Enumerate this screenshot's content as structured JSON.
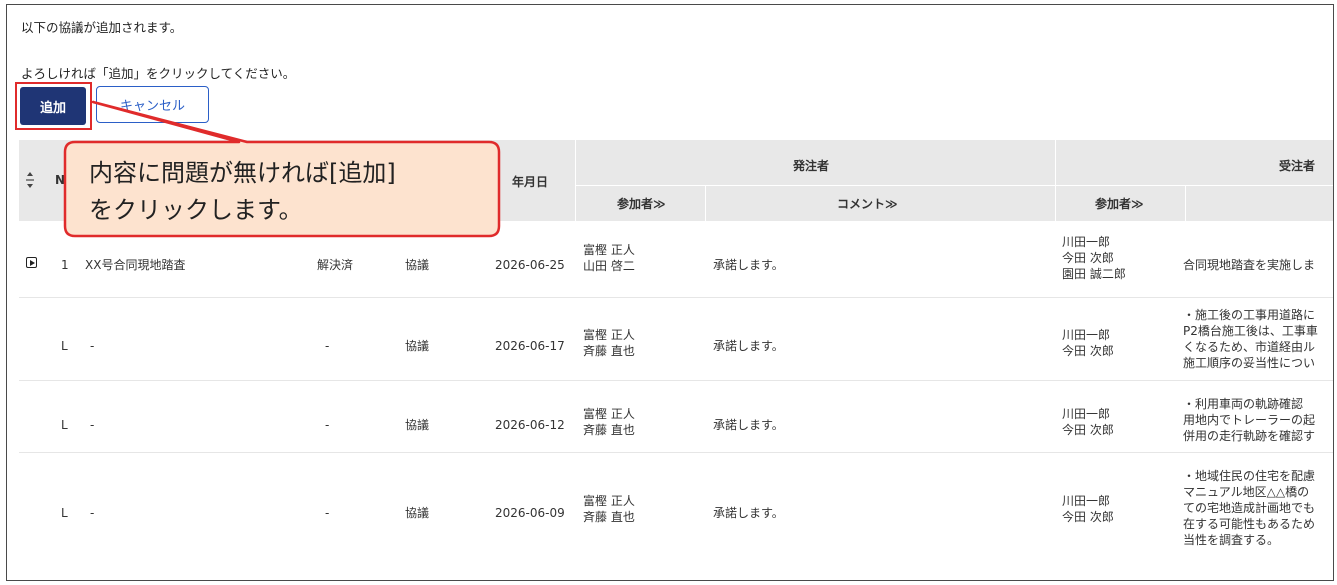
{
  "messages": {
    "line1": "以下の協議が追加されます。",
    "line2": "よろしければ「追加」をクリックしてください。"
  },
  "buttons": {
    "add": "追加",
    "cancel": "キャンセル"
  },
  "table": {
    "sort_icon": "sort-arrows-icon",
    "col_no": "N",
    "col_date": "年月日",
    "group_orderer": "発注者",
    "group_contractor": "受注者",
    "sub_participants": "参加者≫",
    "sub_comment": "コメント≫",
    "rows": [
      {
        "marker": "1",
        "title": "XX号合同現地踏査",
        "status": "解決済",
        "type": "協議",
        "date": "2026-06-25",
        "o_participants": [
          "富樫 正人",
          "山田 啓二"
        ],
        "o_comment": "承諾します。",
        "c_participants": [
          "川田一郎",
          "今田 次郎",
          "園田 誠二郎"
        ],
        "c_comment": [
          "合同現地踏査を実施しま"
        ]
      },
      {
        "marker": "L",
        "title": "-",
        "status": "-",
        "type": "協議",
        "date": "2026-06-17",
        "o_participants": [
          "富樫 正人",
          "斉藤 直也"
        ],
        "o_comment": "承諾します。",
        "c_participants": [
          "川田一郎",
          "今田 次郎"
        ],
        "c_comment": [
          "・施工後の工事用道路に",
          "P2橋台施工後は、工事車",
          "くなるため、市道経由ル",
          "施工順序の妥当性につい"
        ]
      },
      {
        "marker": "L",
        "title": "-",
        "status": "-",
        "type": "協議",
        "date": "2026-06-12",
        "o_participants": [
          "富樫 正人",
          "斉藤 直也"
        ],
        "o_comment": "承諾します。",
        "c_participants": [
          "川田一郎",
          "今田 次郎"
        ],
        "c_comment": [
          "・利用車両の軌跡確認",
          "用地内でトレーラーの起",
          "併用の走行軌跡を確認す"
        ]
      },
      {
        "marker": "L",
        "title": "-",
        "status": "-",
        "type": "協議",
        "date": "2026-06-09",
        "o_participants": [
          "富樫 正人",
          "斉藤 直也"
        ],
        "o_comment": "承諾します。",
        "c_participants": [
          "川田一郎",
          "今田 次郎"
        ],
        "c_comment": [
          "・地域住民の住宅を配慮",
          "マニュアル地区△△橋の",
          "ての宅地造成計画地でも",
          "在する可能性もあるため",
          "当性を調査する。"
        ]
      }
    ]
  },
  "callout": {
    "line1": "内容に問題が無ければ[追加]",
    "line2": "をクリックします。"
  },
  "colors": {
    "primary": "#1f3575",
    "highlight": "#e02b2b",
    "callout_fill": "#fde3cf"
  }
}
